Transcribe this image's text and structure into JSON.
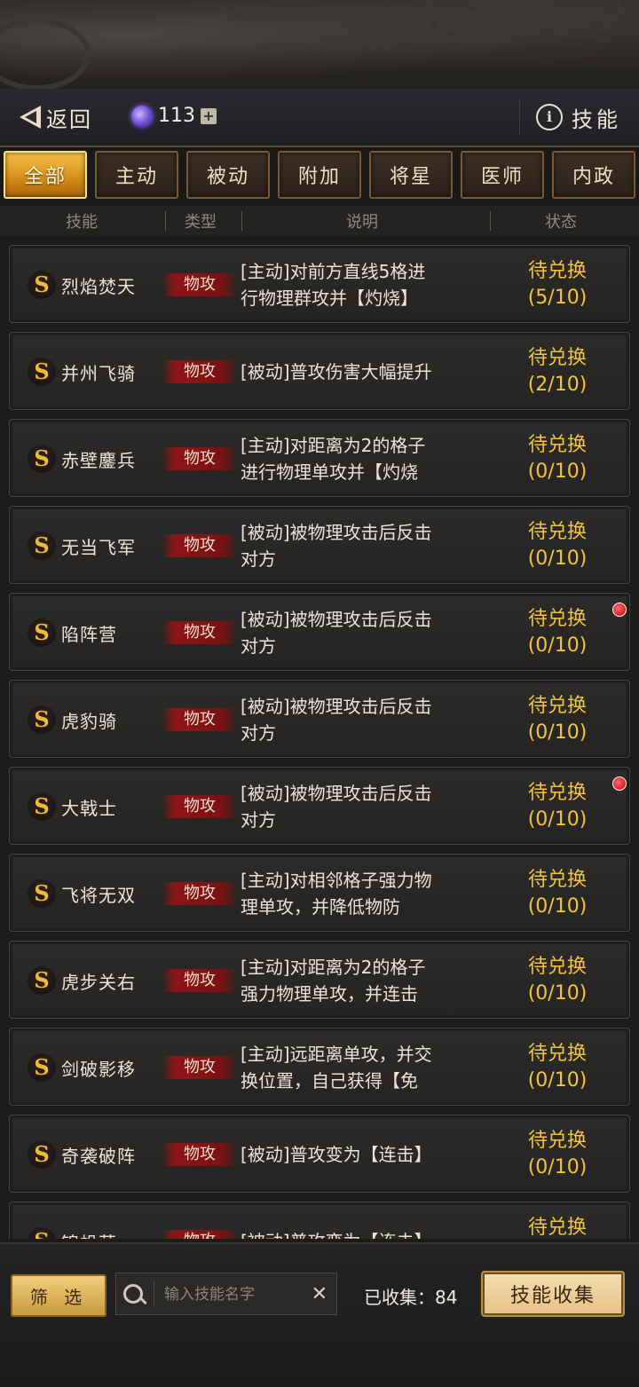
{
  "header": {
    "back_label": "返回",
    "gem_count": "113",
    "right_label": "技能"
  },
  "tabs": [
    "全部",
    "主动",
    "被动",
    "附加",
    "将星",
    "医师",
    "内政"
  ],
  "columns": [
    "技能",
    "类型",
    "说明",
    "状态"
  ],
  "rows": [
    {
      "badge": "S",
      "name": "烈焰焚天",
      "type": "物攻",
      "desc1": "[主动]对前方直线5格进",
      "desc2": "行物理群攻并【灼烧】",
      "status1": "待兑换",
      "status2": "(5/10)",
      "dot": false
    },
    {
      "badge": "S",
      "name": "并州飞骑",
      "type": "物攻",
      "desc1": "[被动]普攻伤害大幅提升",
      "desc2": "",
      "status1": "待兑换",
      "status2": "(2/10)",
      "dot": false
    },
    {
      "badge": "S",
      "name": "赤壁鏖兵",
      "type": "物攻",
      "desc1": "[主动]对距离为2的格子",
      "desc2": "进行物理单攻并【灼烧",
      "status1": "待兑换",
      "status2": "(0/10)",
      "dot": false
    },
    {
      "badge": "S",
      "name": "无当飞军",
      "type": "物攻",
      "desc1": "[被动]被物理攻击后反击",
      "desc2": "对方",
      "status1": "待兑换",
      "status2": "(0/10)",
      "dot": false
    },
    {
      "badge": "S",
      "name": "陷阵营",
      "type": "物攻",
      "desc1": "[被动]被物理攻击后反击",
      "desc2": "对方",
      "status1": "待兑换",
      "status2": "(0/10)",
      "dot": true
    },
    {
      "badge": "S",
      "name": "虎豹骑",
      "type": "物攻",
      "desc1": "[被动]被物理攻击后反击",
      "desc2": "对方",
      "status1": "待兑换",
      "status2": "(0/10)",
      "dot": false
    },
    {
      "badge": "S",
      "name": "大戟士",
      "type": "物攻",
      "desc1": "[被动]被物理攻击后反击",
      "desc2": "对方",
      "status1": "待兑换",
      "status2": "(0/10)",
      "dot": true
    },
    {
      "badge": "S",
      "name": "飞将无双",
      "type": "物攻",
      "desc1": "[主动]对相邻格子强力物",
      "desc2": "理单攻，并降低物防",
      "status1": "待兑换",
      "status2": "(0/10)",
      "dot": false
    },
    {
      "badge": "S",
      "name": "虎步关右",
      "type": "物攻",
      "desc1": "[主动]对距离为2的格子",
      "desc2": "强力物理单攻，并连击",
      "status1": "待兑换",
      "status2": "(0/10)",
      "dot": false
    },
    {
      "badge": "S",
      "name": "剑破影移",
      "type": "物攻",
      "desc1": "[主动]远距离单攻，并交",
      "desc2": "换位置，自己获得【免",
      "status1": "待兑换",
      "status2": "(0/10)",
      "dot": false
    },
    {
      "badge": "S",
      "name": "奇袭破阵",
      "type": "物攻",
      "desc1": "[被动]普攻变为【连击】",
      "desc2": "",
      "status1": "待兑换",
      "status2": "(0/10)",
      "dot": false
    },
    {
      "badge": "S",
      "name": "锦帆营",
      "type": "物攻",
      "desc1": "[被动]普攻变为【连击】",
      "desc2": "",
      "status1": "待兑换",
      "status2": "",
      "dot": false
    }
  ],
  "bottom": {
    "filter_label": "筛 选",
    "search_placeholder": "输入技能名字",
    "clear_symbol": "✕",
    "collected_label": "已收集：",
    "collected_count": "84",
    "collect_button": "技能收集"
  }
}
